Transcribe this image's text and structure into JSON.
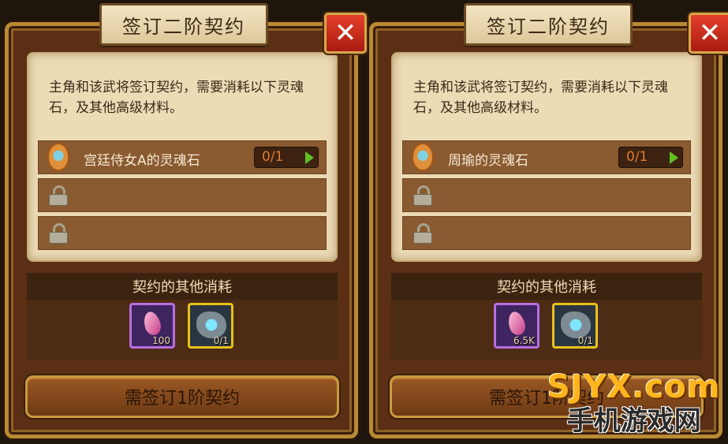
{
  "panels": [
    {
      "title": "签订二阶契约",
      "close_label": "✕",
      "description": "主角和该武将签订契约，需要消耗以下灵魂石，及其他高级材料。",
      "soul_item_name": "宫廷侍女A的灵魂石",
      "soul_item_count": "0/1",
      "other_costs_label": "契约的其他消耗",
      "cost_items": [
        {
          "icon": "pink-crystal-icon",
          "count": "100"
        },
        {
          "icon": "blue-stone-icon",
          "count": "0/1"
        }
      ],
      "button_label": "需签订1阶契约"
    },
    {
      "title": "签订二阶契约",
      "close_label": "✕",
      "description": "主角和该武将签订契约，需要消耗以下灵魂石，及其他高级材料。",
      "soul_item_name": "周瑜的灵魂石",
      "soul_item_count": "0/1",
      "other_costs_label": "契约的其他消耗",
      "cost_items": [
        {
          "icon": "pink-crystal-icon",
          "count": "6.5K"
        },
        {
          "icon": "blue-stone-icon",
          "count": "0/1"
        }
      ],
      "button_label": "需签订1阶契约"
    }
  ],
  "watermark": {
    "line1": "SJYX.com",
    "line2": "手机游戏网"
  },
  "colors": {
    "frame": "#5a2f14",
    "parchment": "#ecdcb6",
    "row": "#8a5a31",
    "count_text": "#e07a30",
    "arrow": "#5ec01e",
    "close_button": "#c9281a"
  }
}
